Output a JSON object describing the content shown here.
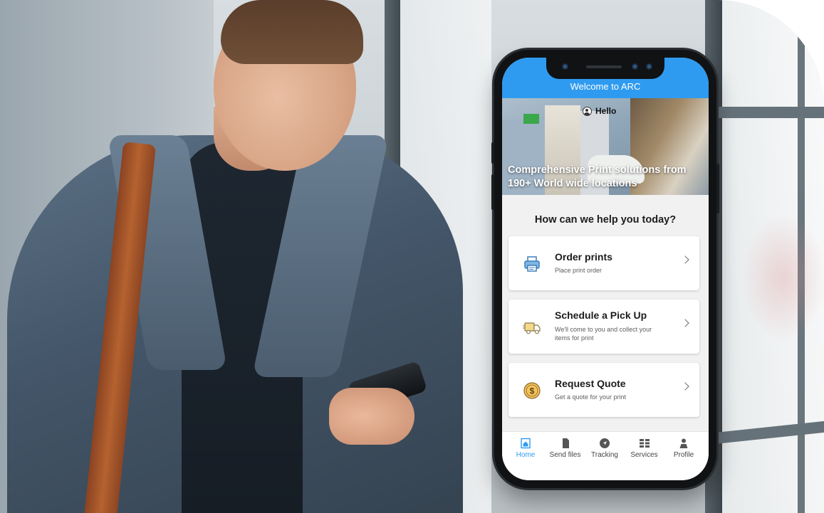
{
  "app": {
    "header_title": "Welcome to ARC",
    "accent_color": "#2f9bf0"
  },
  "banner": {
    "greeting": "Hello",
    "tagline": "Comprehensive Print solutions from 190+ World wide locations"
  },
  "main": {
    "heading": "How can we help you today?",
    "actions": [
      {
        "title": "Order prints",
        "subtitle": "Place print order",
        "icon": "printer-icon"
      },
      {
        "title": "Schedule a Pick Up",
        "subtitle": "We'll come to you and collect your items for print",
        "icon": "delivery-truck-icon"
      },
      {
        "title": "Request Quote",
        "subtitle": "Get a quote for your print",
        "icon": "dollar-coin-icon"
      }
    ]
  },
  "tabbar": {
    "items": [
      {
        "label": "Home",
        "icon": "home-icon",
        "active": true
      },
      {
        "label": "Send files",
        "icon": "file-icon",
        "active": false
      },
      {
        "label": "Tracking",
        "icon": "location-arrow-icon",
        "active": false
      },
      {
        "label": "Services",
        "icon": "grid-list-icon",
        "active": false
      },
      {
        "label": "Profile",
        "icon": "person-icon",
        "active": false
      }
    ]
  }
}
